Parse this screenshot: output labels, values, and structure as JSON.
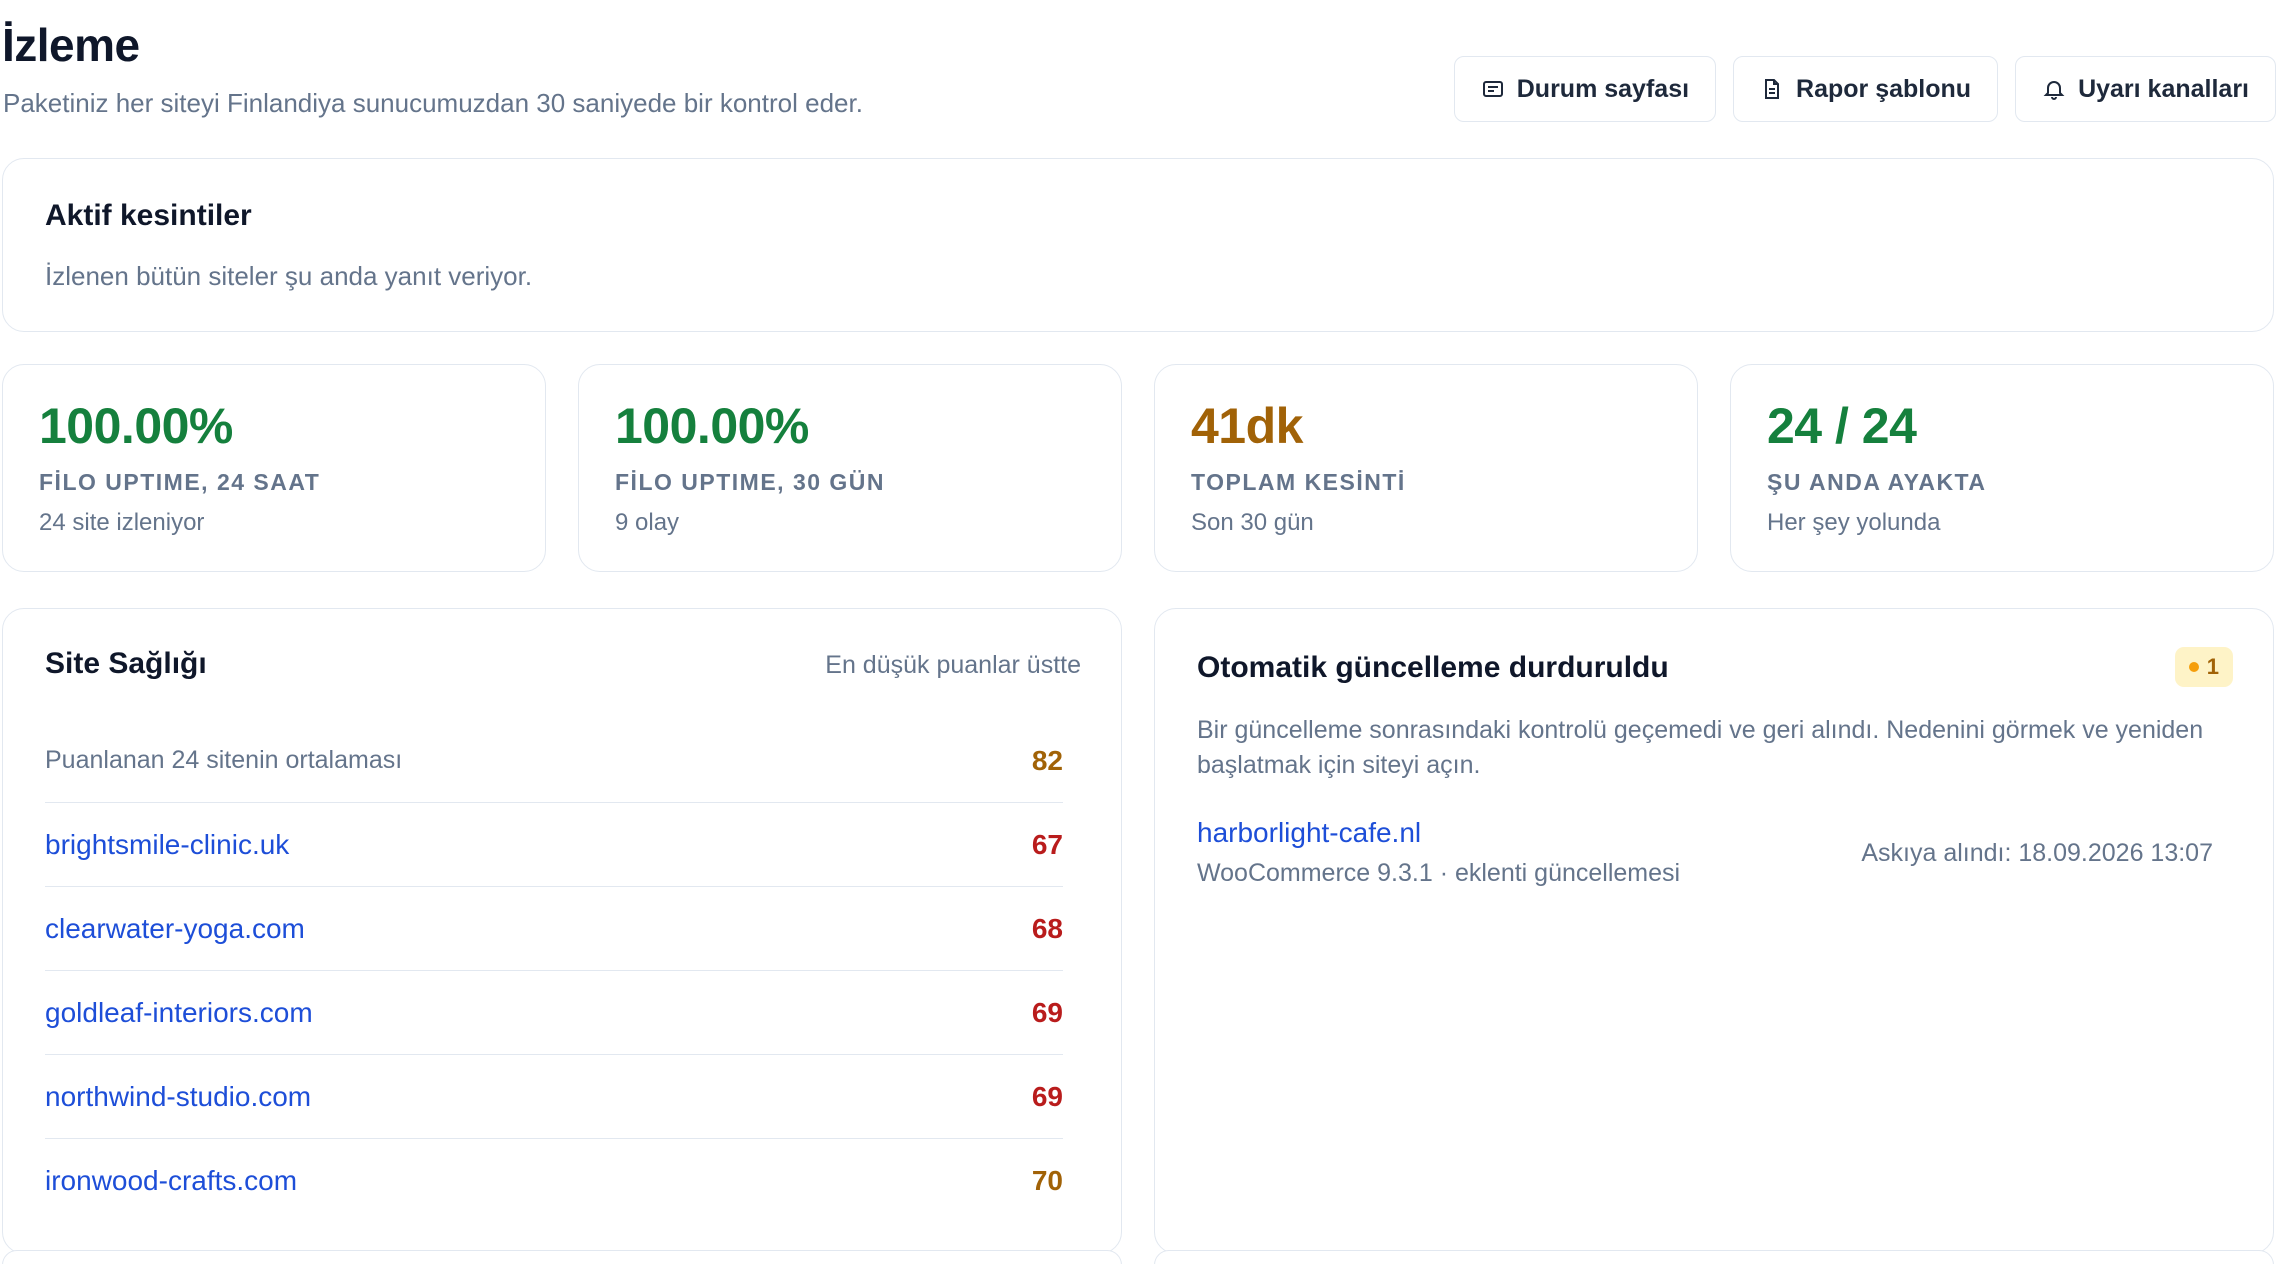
{
  "header": {
    "title": "İzleme",
    "subtitle": "Paketiniz her siteyi Finlandiya sunucumuzdan 30 saniyede bir kontrol eder.",
    "actions": [
      {
        "label": "Durum sayfası",
        "icon": "status-page-icon"
      },
      {
        "label": "Rapor şablonu",
        "icon": "document-icon"
      },
      {
        "label": "Uyarı kanalları",
        "icon": "bell-icon"
      }
    ]
  },
  "outages": {
    "title": "Aktif kesintiler",
    "text": "İzlenen bütün siteler şu anda yanıt veriyor."
  },
  "stats": [
    {
      "value": "100.00%",
      "label": "FİLO UPTIME, 24 SAAT",
      "sub": "24 site izleniyor",
      "color": "#15803d"
    },
    {
      "value": "100.00%",
      "label": "FİLO UPTIME, 30 GÜN",
      "sub": "9 olay",
      "color": "#15803d"
    },
    {
      "value": "41dk",
      "label": "TOPLAM KESİNTİ",
      "sub": "Son 30 gün",
      "color": "#a16207"
    },
    {
      "value": "24 / 24",
      "label": "ŞU ANDA AYAKTA",
      "sub": "Her şey yolunda",
      "color": "#15803d"
    }
  ],
  "health": {
    "title": "Site Sağlığı",
    "hint": "En düşük puanlar üstte",
    "average_label": "Puanlanan 24 sitenin ortalaması",
    "average_score": "82",
    "sites": [
      {
        "name": "brightsmile-clinic.uk",
        "score": "67"
      },
      {
        "name": "clearwater-yoga.com",
        "score": "68"
      },
      {
        "name": "goldleaf-interiors.com",
        "score": "69"
      },
      {
        "name": "northwind-studio.com",
        "score": "69"
      },
      {
        "name": "ironwood-crafts.com",
        "score": "70"
      }
    ]
  },
  "paused": {
    "title": "Otomatik güncelleme durduruldu",
    "badge_count": "1",
    "description": "Bir güncelleme sonrasındaki kontrolü geçemedi ve geri alındı. Nedenini görmek ve yeniden başlatmak için siteyi açın.",
    "site": "harborlight-cafe.nl",
    "meta": "WooCommerce 9.3.1 · eklenti güncellemesi",
    "time": "Askıya alındı: 18.09.2026 13:07"
  },
  "colors": {
    "green": "#15803d",
    "amber": "#a16207",
    "red": "#b91c1c",
    "link": "#1d4ed8"
  }
}
